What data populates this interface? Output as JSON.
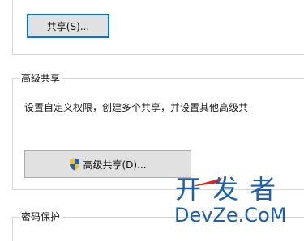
{
  "share_section": {
    "share_button_label": "共享(S)..."
  },
  "advanced_sharing": {
    "group_title": "高级共享",
    "description": "设置自定义权限，创建多个共享，并设置其他高级共",
    "button_label": "高级共享(D)...",
    "button_icon": "uac-shield-icon"
  },
  "password_protection": {
    "group_title": "密码保护"
  },
  "watermark": {
    "chinese": "开发者",
    "english": "DevZe.CoM"
  },
  "colors": {
    "accent": "#0078d7",
    "watermark": "#1d5fa8",
    "watermark_arrow": "#e02020"
  }
}
